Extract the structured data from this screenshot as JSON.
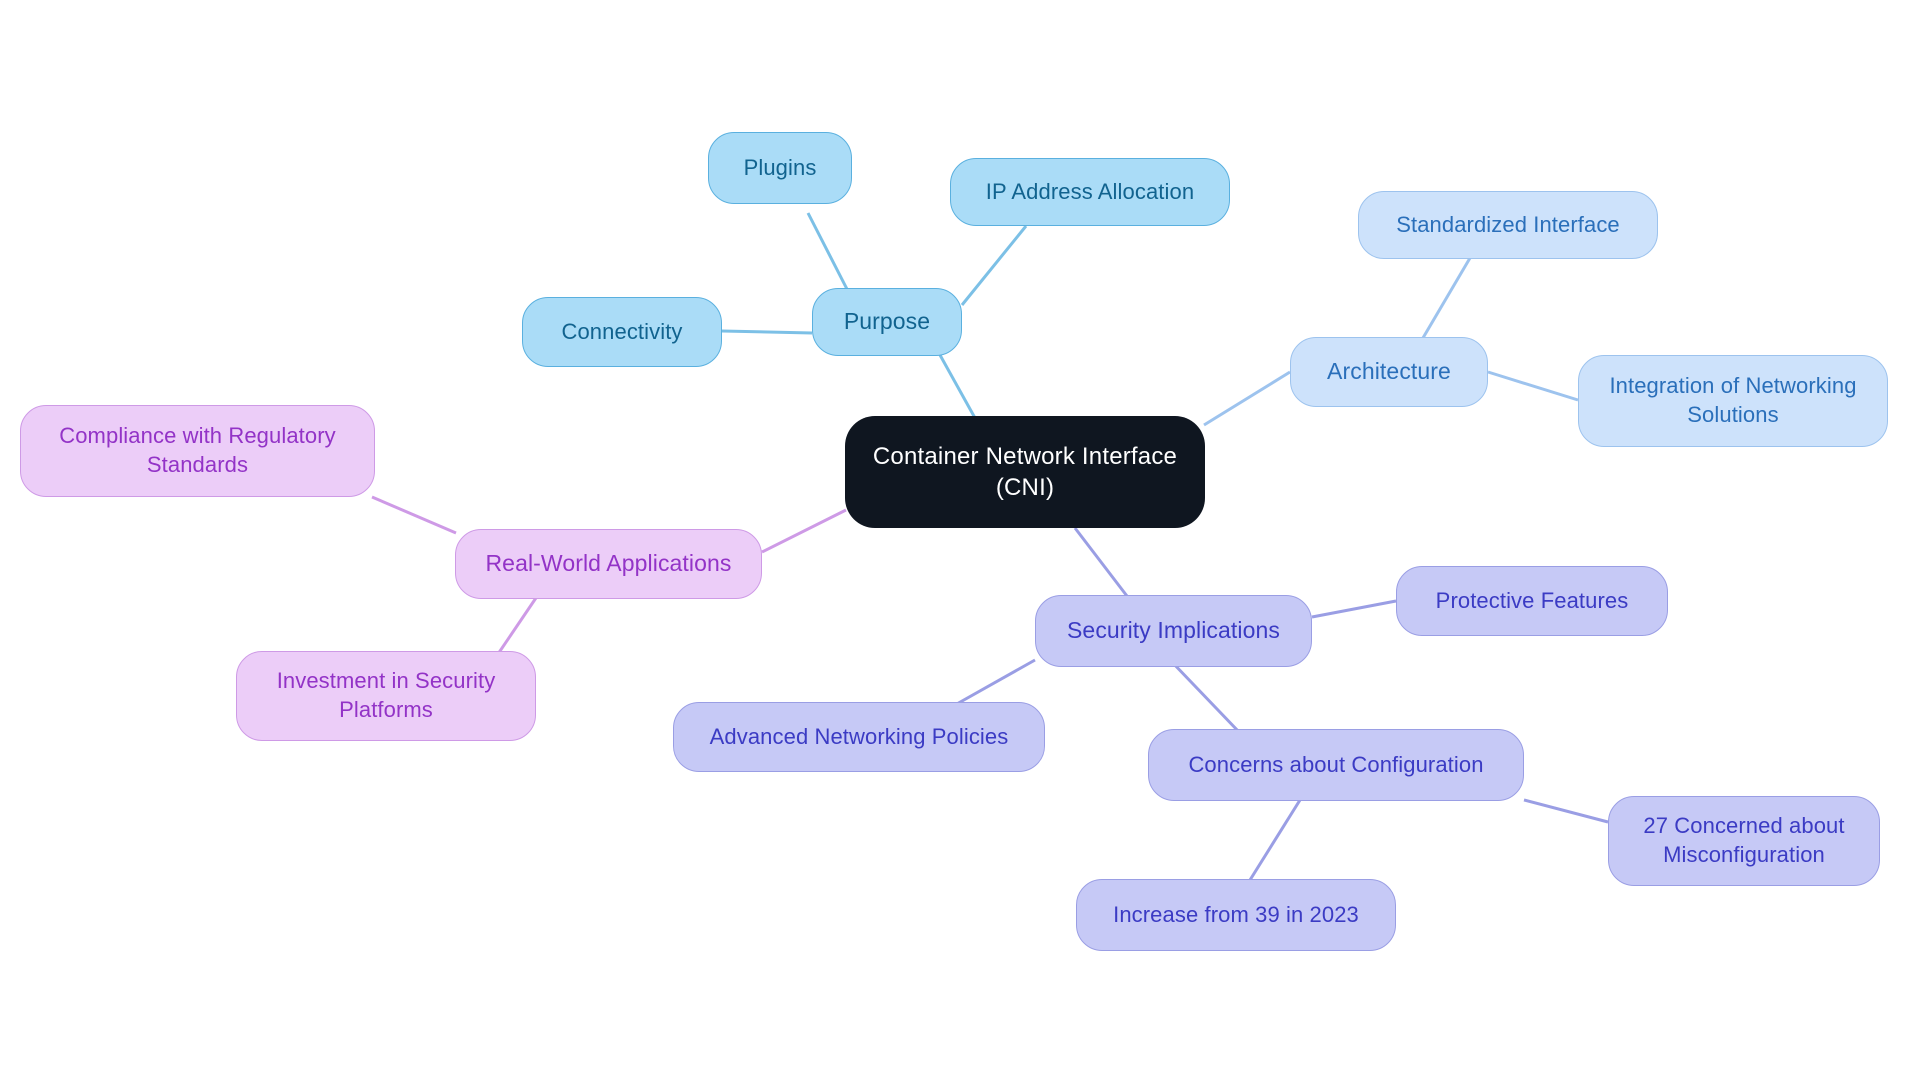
{
  "diagram": {
    "type": "mindmap",
    "title": "Container Network Interface (CNI)",
    "background": "#ffffff"
  },
  "palette": {
    "root_fill": "#0f1620",
    "root_text": "#ffffff",
    "purpose_fill": "#aadcf7",
    "purpose_border": "#5ab0df",
    "purpose_text": "#11638f",
    "architecture_fill": "#cde2fb",
    "architecture_border": "#9dc3ee",
    "architecture_text": "#2a6fba",
    "security_fill": "#c6c9f6",
    "security_border": "#9a9ee4",
    "security_text": "#3b3bc4",
    "applications_fill": "#eccdf8",
    "applications_border": "#ce9ae6",
    "applications_text": "#9333c7"
  },
  "nodes": {
    "root": {
      "label": "Container Network Interface\n(CNI)"
    },
    "purpose": {
      "label": "Purpose"
    },
    "plugins": {
      "label": "Plugins"
    },
    "connectivity": {
      "label": "Connectivity"
    },
    "ip_address_allocation": {
      "label": "IP Address Allocation"
    },
    "architecture": {
      "label": "Architecture"
    },
    "standardized_interface": {
      "label": "Standardized Interface"
    },
    "integration_of_networking_solutions": {
      "label": "Integration of Networking\nSolutions"
    },
    "security_implications": {
      "label": "Security Implications"
    },
    "protective_features": {
      "label": "Protective Features"
    },
    "advanced_networking_policies": {
      "label": "Advanced Networking Policies"
    },
    "concerns_about_configuration": {
      "label": "Concerns about Configuration"
    },
    "misconfiguration_stat": {
      "label": "27 Concerned about\nMisconfiguration"
    },
    "increase_stat": {
      "label": "Increase from 39 in 2023"
    },
    "real_world_applications": {
      "label": "Real-World Applications"
    },
    "compliance_regulatory": {
      "label": "Compliance with Regulatory\nStandards"
    },
    "investment_security_platforms": {
      "label": "Investment in Security\nPlatforms"
    }
  },
  "chart_data": {
    "type": "mindmap",
    "title": "Container Network Interface (CNI)",
    "center": "Container Network Interface (CNI)",
    "branches": [
      {
        "name": "Purpose",
        "color": "#aadcf7",
        "children": [
          "Plugins",
          "Connectivity",
          "IP Address Allocation"
        ]
      },
      {
        "name": "Architecture",
        "color": "#cde2fb",
        "children": [
          "Standardized Interface",
          "Integration of Networking Solutions"
        ]
      },
      {
        "name": "Security Implications",
        "color": "#c6c9f6",
        "children": [
          "Protective Features",
          "Advanced Networking Policies",
          {
            "name": "Concerns about Configuration",
            "children": [
              "27 Concerned about Misconfiguration",
              "Increase from 39 in 2023"
            ]
          }
        ]
      },
      {
        "name": "Real-World Applications",
        "color": "#eccdf8",
        "children": [
          "Compliance with Regulatory Standards",
          "Investment in Security Platforms"
        ]
      }
    ]
  }
}
